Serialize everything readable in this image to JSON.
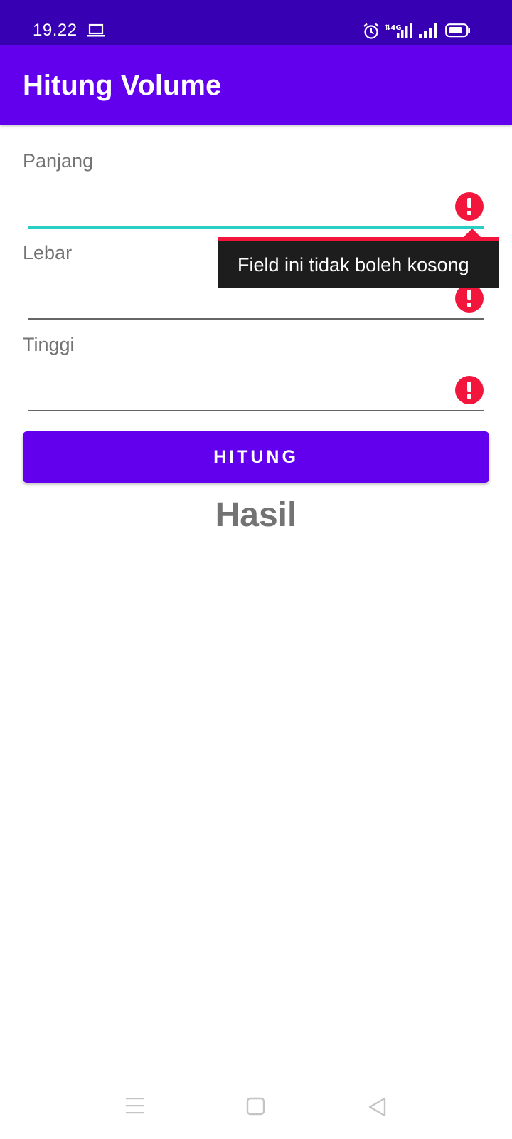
{
  "status_bar": {
    "time": "19.22",
    "icons": [
      "laptop-icon",
      "alarm-icon",
      "4g-network-icon",
      "signal-icon",
      "battery-icon"
    ]
  },
  "app_bar": {
    "title": "Hitung Volume"
  },
  "form": {
    "fields": [
      {
        "label": "Panjang",
        "value": "",
        "error": true,
        "focused": true
      },
      {
        "label": "Lebar",
        "value": "",
        "error": true,
        "focused": false
      },
      {
        "label": "Tinggi",
        "value": "",
        "error": true,
        "focused": false
      }
    ],
    "error_message": "Field ini tidak boleh kosong",
    "button_label": "HITUNG"
  },
  "result": {
    "label": "Hasil"
  },
  "nav_bar": {
    "icons": [
      "menu-icon",
      "home-icon",
      "back-icon"
    ]
  },
  "colors": {
    "status_bar": "#3700b3",
    "primary": "#6200ee",
    "focus_underline": "#2acfc3",
    "error": "#f2163d",
    "popup_background": "#1d1d1d",
    "label_text": "#737373"
  }
}
